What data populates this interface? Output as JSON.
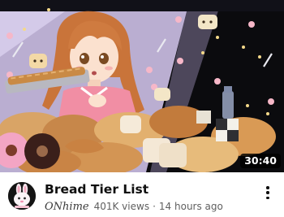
{
  "video": {
    "title": "Bread Tier List",
    "duration": "30:40",
    "thumbnail_icon": "anime-girl-bread-thumbnail"
  },
  "channel": {
    "name": "ONhime",
    "avatar_icon": "bunny-avatar-icon"
  },
  "stats": {
    "views": "401K views",
    "separator": "·",
    "uploaded": "14 hours ago"
  },
  "actions": {
    "more_icon": "vertical-ellipsis-icon"
  },
  "colors": {
    "title": "#0f0f0f",
    "meta_text": "#606060",
    "thumb_bg": "#0b0b0e",
    "spotlight": "#d8c8f3",
    "shirt": "#f18ea4",
    "hair": "#c9743a"
  }
}
